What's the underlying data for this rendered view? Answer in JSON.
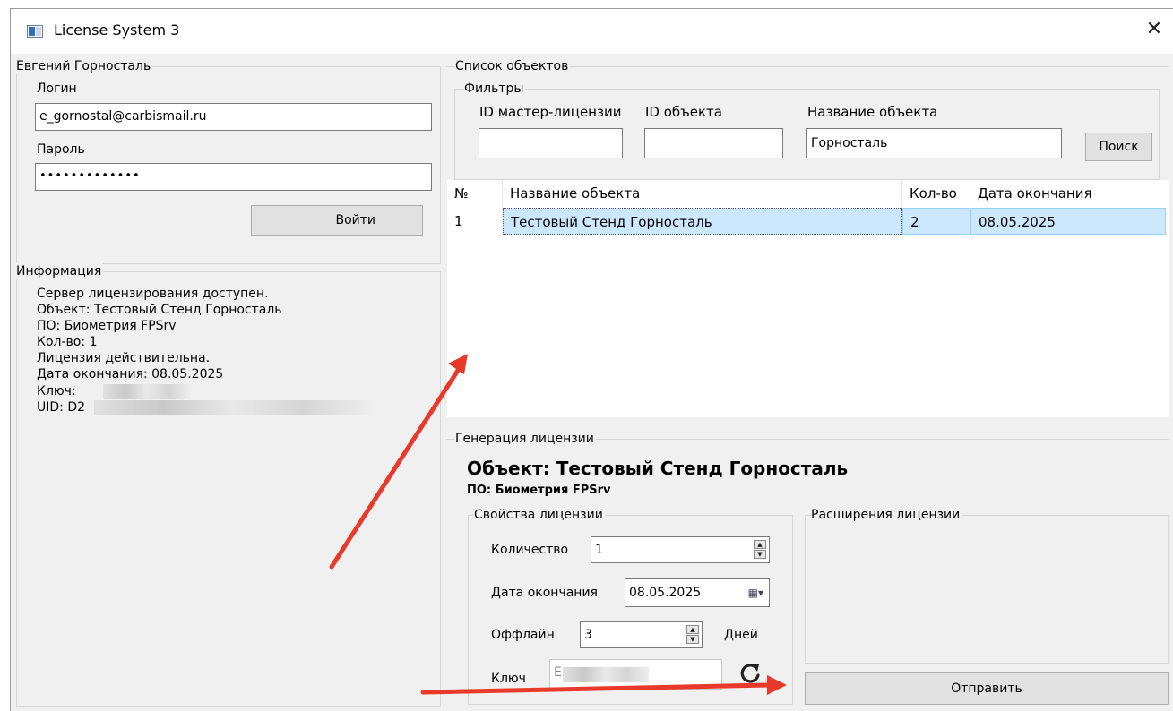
{
  "window": {
    "title": "License System 3"
  },
  "login": {
    "group_title": "Евгений Горносталь",
    "login_label": "Логин",
    "login_value": "e_gornostal@carbismail.ru",
    "password_label": "Пароль",
    "password_value": "•••••••••••••",
    "submit_label": "Войти"
  },
  "info": {
    "group_title": "Информация",
    "lines": [
      "Сервер лицензирования доступен.",
      " Объект: Тестовый Стенд Горносталь",
      " ПО: Биометрия FPSrv",
      " Кол-во: 1",
      "Лицензия действительна.",
      "Дата окончания: 08.05.2025",
      "Ключ: ",
      "UID: D2"
    ]
  },
  "objects": {
    "group_title": "Список объектов",
    "filters": {
      "group_title": "Фильтры",
      "master_id_label": "ID мастер-лицензии",
      "master_id_value": "",
      "object_id_label": "ID объекта",
      "object_id_value": "",
      "name_label": "Название объекта",
      "name_value": "Горносталь",
      "search_label": "Поиск"
    },
    "columns": [
      "№",
      "Название объекта",
      "Кол-во",
      "Дата окончания"
    ],
    "rows": [
      {
        "num": "1",
        "name": "Тестовый Стенд Горносталь",
        "qty": "2",
        "end_date": "08.05.2025"
      }
    ]
  },
  "generation": {
    "group_title": "Генерация лицензии",
    "object_heading": "Объект: Тестовый Стенд Горносталь",
    "software_heading": "ПО: Биометрия FPSrv",
    "props": {
      "group_title": "Свойства лицензии",
      "quantity_label": "Количество",
      "quantity_value": "1",
      "end_date_label": "Дата окончания",
      "end_date_value": "08.05.2025",
      "offline_label": "Оффлайн",
      "offline_value": "3",
      "offline_unit": "Дней",
      "key_label": "Ключ",
      "key_value": "E"
    },
    "extensions": {
      "group_title": "Расширения лицензии"
    },
    "send_label": "Отправить"
  },
  "colors": {
    "selection": "#cce8ff",
    "arrow": "#e8392b"
  }
}
